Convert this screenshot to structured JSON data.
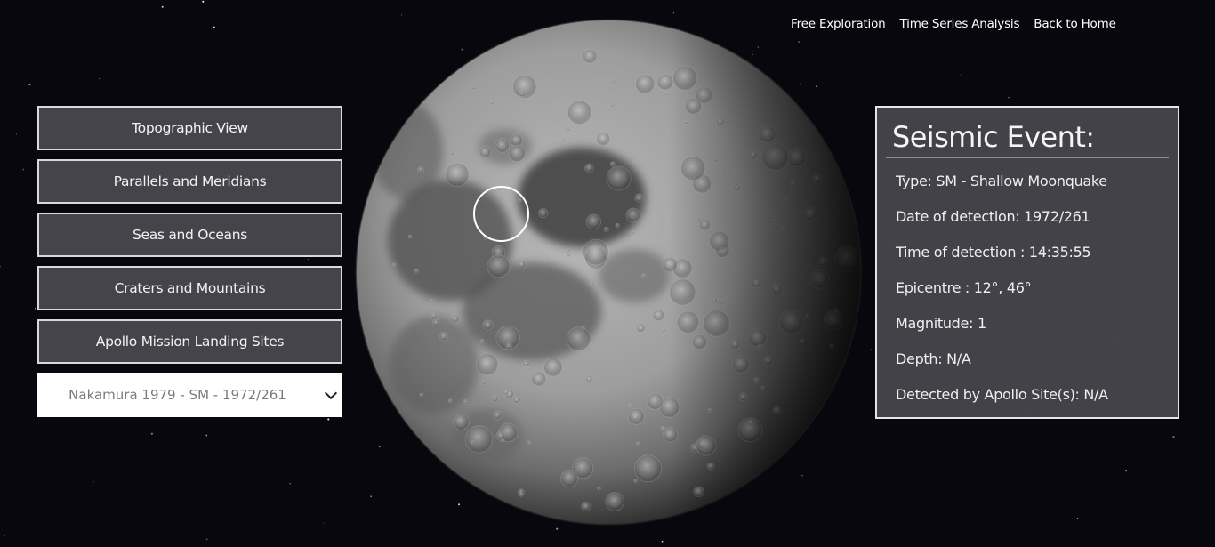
{
  "nav": {
    "free_exploration": "Free Exploration",
    "time_series": "Time Series Analysis",
    "back_home": "Back to Home"
  },
  "layers": {
    "topographic": "Topographic View",
    "parallels": "Parallels and Meridians",
    "seas": "Seas and Oceans",
    "craters": "Craters and Mountains",
    "apollo": "Apollo Mission Landing Sites"
  },
  "event_select": {
    "selected": "Nakamura 1979 - SM - 1972/261"
  },
  "event_panel": {
    "title": "Seismic Event:",
    "type": "Type: SM - Shallow Moonquake",
    "date": "Date of detection: 1972/261",
    "time": "Time of detection : 14:35:55",
    "epicentre": "Epicentre : 12°, 46°",
    "magnitude": "Magnitude: 1",
    "depth": "Depth: N/A",
    "detected_by": "Detected by Apollo Site(s): N/A"
  },
  "colors": {
    "background": "#07070d",
    "button_bg": "#45444a",
    "button_border": "#d9d9dc",
    "panel_bg": "#46454b",
    "moon_highland": "#a9a9a9",
    "moon_mare": "#555555"
  },
  "icons": {
    "select_arrow": "chevron-down-icon",
    "event_marker": "circle-marker-icon"
  }
}
